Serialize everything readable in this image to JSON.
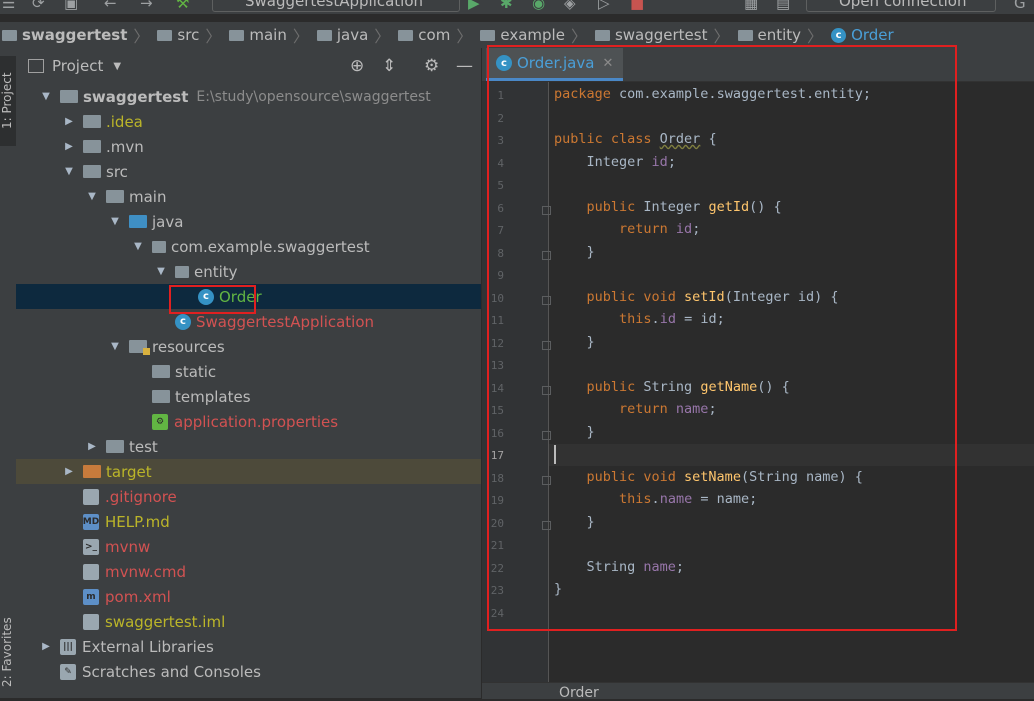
{
  "toolbar": {
    "run_config": "SwaggertestApplication",
    "open_connection": "Open connection",
    "icons": [
      "menu-icon",
      "refresh-icon",
      "save-icon",
      "back-icon",
      "forward-icon",
      "build-icon",
      "run-icon",
      "debug-icon",
      "coverage-icon",
      "profile-icon",
      "stop-icon",
      "layout-icon",
      "database-icon"
    ]
  },
  "breadcrumb": [
    "swaggertest",
    "src",
    "main",
    "java",
    "com",
    "example",
    "swaggertest",
    "entity",
    "Order"
  ],
  "stripe": {
    "project_tab": "1: Project",
    "favorites_tab": "2: Favorites"
  },
  "project_panel": {
    "title": "Project",
    "tree": [
      {
        "label": "swaggertest",
        "path": "E:\\study\\opensource\\swaggertest",
        "depth": 0,
        "arrow": "down",
        "icon": "module",
        "color": "#bbbbbb",
        "bold": true
      },
      {
        "label": ".idea",
        "depth": 1,
        "arrow": "right",
        "icon": "folder",
        "color": "#bbb529"
      },
      {
        "label": ".mvn",
        "depth": 1,
        "arrow": "right",
        "icon": "folder",
        "color": "#bbbbbb"
      },
      {
        "label": "src",
        "depth": 1,
        "arrow": "down",
        "icon": "folder",
        "color": "#bbbbbb"
      },
      {
        "label": "main",
        "depth": 2,
        "arrow": "down",
        "icon": "folder",
        "color": "#bbbbbb"
      },
      {
        "label": "java",
        "depth": 3,
        "arrow": "down",
        "icon": "folder-blue",
        "color": "#bbbbbb"
      },
      {
        "label": "com.example.swaggertest",
        "depth": 4,
        "arrow": "down",
        "icon": "package",
        "color": "#bbbbbb"
      },
      {
        "label": "entity",
        "depth": 5,
        "arrow": "down",
        "icon": "package",
        "color": "#bbbbbb"
      },
      {
        "label": "Order",
        "depth": 6,
        "arrow": "none",
        "icon": "class",
        "color": "#62b543",
        "selected": true
      },
      {
        "label": "SwaggertestApplication",
        "depth": 5,
        "arrow": "none",
        "icon": "spring-class",
        "color": "#d25252"
      },
      {
        "label": "resources",
        "depth": 3,
        "arrow": "down",
        "icon": "resources",
        "color": "#bbbbbb"
      },
      {
        "label": "static",
        "depth": 4,
        "arrow": "none",
        "icon": "folder",
        "color": "#bbbbbb"
      },
      {
        "label": "templates",
        "depth": 4,
        "arrow": "none",
        "icon": "folder",
        "color": "#bbbbbb"
      },
      {
        "label": "application.properties",
        "depth": 4,
        "arrow": "none",
        "icon": "spring-props",
        "color": "#d25252"
      },
      {
        "label": "test",
        "depth": 2,
        "arrow": "right",
        "icon": "folder",
        "color": "#bbbbbb"
      },
      {
        "label": "target",
        "depth": 1,
        "arrow": "right",
        "icon": "folder-orange",
        "color": "#bbb529",
        "excluded": true
      },
      {
        "label": ".gitignore",
        "depth": 1,
        "arrow": "none",
        "icon": "file",
        "color": "#d25252"
      },
      {
        "label": "HELP.md",
        "depth": 1,
        "arrow": "none",
        "icon": "md",
        "color": "#bbb529"
      },
      {
        "label": "mvnw",
        "depth": 1,
        "arrow": "none",
        "icon": "terminal",
        "color": "#d25252"
      },
      {
        "label": "mvnw.cmd",
        "depth": 1,
        "arrow": "none",
        "icon": "file",
        "color": "#d25252"
      },
      {
        "label": "pom.xml",
        "depth": 1,
        "arrow": "none",
        "icon": "maven",
        "color": "#d25252"
      },
      {
        "label": "swaggertest.iml",
        "depth": 1,
        "arrow": "none",
        "icon": "file",
        "color": "#bbb529"
      },
      {
        "label": "External Libraries",
        "depth": 0,
        "arrow": "right",
        "icon": "libraries",
        "color": "#bbbbbb"
      },
      {
        "label": "Scratches and Consoles",
        "depth": 0,
        "arrow": "none",
        "icon": "scratches",
        "color": "#bbbbbb"
      }
    ]
  },
  "editor": {
    "tab": "Order.java",
    "footer_crumb": "Order",
    "line_numbers": [
      "1",
      "2",
      "3",
      "4",
      "5",
      "6",
      "7",
      "8",
      "9",
      "10",
      "11",
      "12",
      "13",
      "14",
      "15",
      "16",
      "17",
      "18",
      "19",
      "20",
      "21",
      "22",
      "23",
      "24"
    ],
    "current_line": "17",
    "code": [
      [
        {
          "t": "package ",
          "c": "kw"
        },
        {
          "t": "com.example.swaggertest.entity;",
          "c": ""
        }
      ],
      [],
      [
        {
          "t": "public class ",
          "c": "kw"
        },
        {
          "t": "Order",
          "c": "und"
        },
        {
          "t": " {",
          "c": ""
        }
      ],
      [
        {
          "t": "    Integer ",
          "c": ""
        },
        {
          "t": "id",
          "c": "fld"
        },
        {
          "t": ";",
          "c": ""
        }
      ],
      [],
      [
        {
          "t": "    public ",
          "c": "kw"
        },
        {
          "t": "Integer ",
          "c": ""
        },
        {
          "t": "getId",
          "c": "mth"
        },
        {
          "t": "() {",
          "c": ""
        }
      ],
      [
        {
          "t": "        return ",
          "c": "kw"
        },
        {
          "t": "id",
          "c": "fld"
        },
        {
          "t": ";",
          "c": ""
        }
      ],
      [
        {
          "t": "    }",
          "c": ""
        }
      ],
      [],
      [
        {
          "t": "    public void ",
          "c": "kw"
        },
        {
          "t": "setId",
          "c": "mth"
        },
        {
          "t": "(Integer id) {",
          "c": ""
        }
      ],
      [
        {
          "t": "        this",
          "c": "kw"
        },
        {
          "t": ".",
          "c": ""
        },
        {
          "t": "id",
          "c": "fld"
        },
        {
          "t": " = id;",
          "c": ""
        }
      ],
      [
        {
          "t": "    }",
          "c": ""
        }
      ],
      [],
      [
        {
          "t": "    public ",
          "c": "kw"
        },
        {
          "t": "String ",
          "c": ""
        },
        {
          "t": "getName",
          "c": "mth"
        },
        {
          "t": "() {",
          "c": ""
        }
      ],
      [
        {
          "t": "        return ",
          "c": "kw"
        },
        {
          "t": "name",
          "c": "fld"
        },
        {
          "t": ";",
          "c": ""
        }
      ],
      [
        {
          "t": "    }",
          "c": ""
        }
      ],
      [],
      [
        {
          "t": "    public void ",
          "c": "kw"
        },
        {
          "t": "setName",
          "c": "mth"
        },
        {
          "t": "(String name) {",
          "c": ""
        }
      ],
      [
        {
          "t": "        this",
          "c": "kw"
        },
        {
          "t": ".",
          "c": ""
        },
        {
          "t": "name",
          "c": "fld"
        },
        {
          "t": " = name;",
          "c": ""
        }
      ],
      [
        {
          "t": "    }",
          "c": ""
        }
      ],
      [],
      [
        {
          "t": "    String ",
          "c": ""
        },
        {
          "t": "name",
          "c": "fld"
        },
        {
          "t": ";",
          "c": ""
        }
      ],
      [
        {
          "t": "}",
          "c": ""
        }
      ],
      []
    ]
  }
}
